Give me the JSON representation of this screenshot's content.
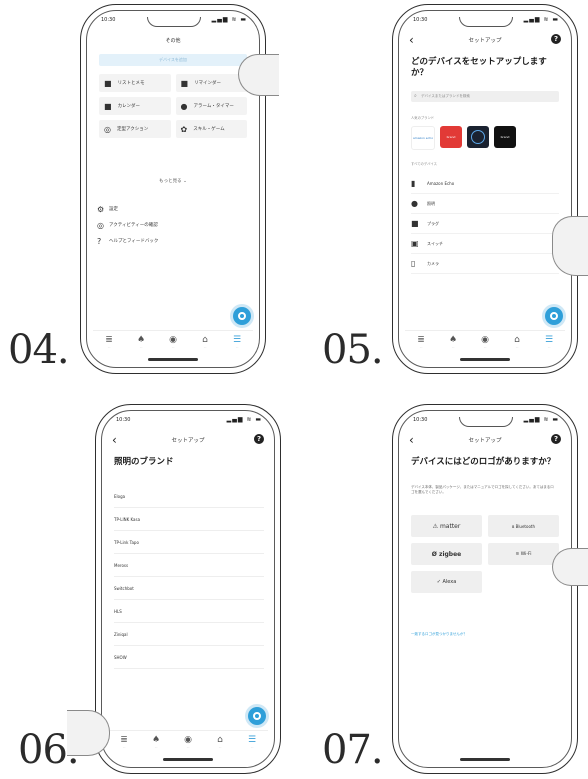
{
  "steps": [
    "04.",
    "05.",
    "06.",
    "07."
  ],
  "status": {
    "time": "10:30",
    "icons": "▂▄▆ ≋ ▬"
  },
  "tabs": [
    {
      "icon": "≣",
      "label": "···"
    },
    {
      "icon": "♠",
      "label": "···"
    },
    {
      "icon": "◉",
      "label": "···"
    },
    {
      "icon": "⌂",
      "label": "···"
    },
    {
      "icon": "☰",
      "label": "···"
    }
  ],
  "phone04": {
    "header": "その他",
    "search": "デバイスを追加",
    "tiles": [
      {
        "icon": "■",
        "label": "リストとメモ"
      },
      {
        "icon": "■",
        "label": "リマインダー"
      },
      {
        "icon": "■",
        "label": "カレンダー"
      },
      {
        "icon": "●",
        "label": "アラーム・タイマー"
      },
      {
        "icon": "◎",
        "label": "定型アクション"
      },
      {
        "icon": "✿",
        "label": "スキル・ゲーム"
      }
    ],
    "more": "もっと見る ⌄",
    "list": [
      {
        "icon": "⚙",
        "label": "設定"
      },
      {
        "icon": "◎",
        "label": "アクティビティーの確認"
      },
      {
        "icon": "?",
        "label": "ヘルプとフィードバック"
      }
    ]
  },
  "phone05": {
    "title": "セットアップ",
    "heading": "どのデバイスをセットアップしますか？",
    "search_placeholder": "デバイスまたはブランドを検索",
    "section1": "人気のブランド",
    "logos": [
      {
        "label": "amazon echo",
        "color": "#ffffff",
        "text": "#2f7ec7"
      },
      {
        "label": "brand",
        "color": "#e23a36",
        "text": "#ffffff"
      },
      {
        "label": "ring",
        "color": "#1a2230",
        "text": "#5aa6e8"
      },
      {
        "label": "brand",
        "color": "#111111",
        "text": "#ffffff"
      }
    ],
    "section2": "すべてのデバイス",
    "devices": [
      {
        "icon": "▮",
        "label": "Amazon Echo"
      },
      {
        "icon": "●",
        "label": "照明"
      },
      {
        "icon": "■",
        "label": "プラグ"
      },
      {
        "icon": "▣",
        "label": "スイッチ"
      },
      {
        "icon": "▯",
        "label": "カメラ"
      }
    ]
  },
  "phone06": {
    "title": "セットアップ",
    "heading": "照明のブランド",
    "brands": [
      "Eloga",
      "TP-LINK Kasa",
      "TP-Link Tapo",
      "Meross",
      "Switchbot",
      "HLS",
      "Ziniqal",
      "SHOW"
    ]
  },
  "phone07": {
    "title": "セットアップ",
    "heading": "デバイスにはどのロゴがありますか？",
    "description": "デバイス本体、製品パッケージ、またはマニュアルでロゴを探してください。あてはまるロゴを選んでください。",
    "logos": [
      "⚠ matter",
      "ʙ Bluetooth",
      "Ø zigbee",
      "≋ Wi-Fi",
      "✓ Alexa"
    ],
    "link": "一致するロゴが見つかりませんか？"
  }
}
